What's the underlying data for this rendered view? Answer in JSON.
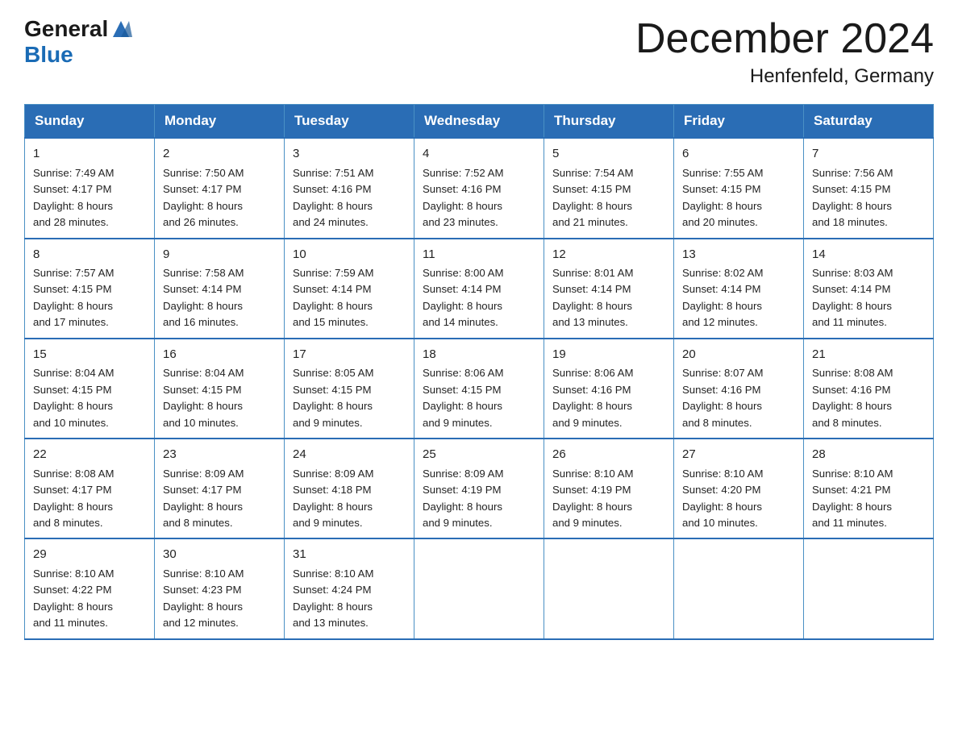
{
  "logo": {
    "text_general": "General",
    "text_blue": "Blue"
  },
  "title": "December 2024",
  "location": "Henfenfeld, Germany",
  "weekdays": [
    "Sunday",
    "Monday",
    "Tuesday",
    "Wednesday",
    "Thursday",
    "Friday",
    "Saturday"
  ],
  "weeks": [
    [
      {
        "day": "1",
        "sunrise": "7:49 AM",
        "sunset": "4:17 PM",
        "daylight": "8 hours and 28 minutes."
      },
      {
        "day": "2",
        "sunrise": "7:50 AM",
        "sunset": "4:17 PM",
        "daylight": "8 hours and 26 minutes."
      },
      {
        "day": "3",
        "sunrise": "7:51 AM",
        "sunset": "4:16 PM",
        "daylight": "8 hours and 24 minutes."
      },
      {
        "day": "4",
        "sunrise": "7:52 AM",
        "sunset": "4:16 PM",
        "daylight": "8 hours and 23 minutes."
      },
      {
        "day": "5",
        "sunrise": "7:54 AM",
        "sunset": "4:15 PM",
        "daylight": "8 hours and 21 minutes."
      },
      {
        "day": "6",
        "sunrise": "7:55 AM",
        "sunset": "4:15 PM",
        "daylight": "8 hours and 20 minutes."
      },
      {
        "day": "7",
        "sunrise": "7:56 AM",
        "sunset": "4:15 PM",
        "daylight": "8 hours and 18 minutes."
      }
    ],
    [
      {
        "day": "8",
        "sunrise": "7:57 AM",
        "sunset": "4:15 PM",
        "daylight": "8 hours and 17 minutes."
      },
      {
        "day": "9",
        "sunrise": "7:58 AM",
        "sunset": "4:14 PM",
        "daylight": "8 hours and 16 minutes."
      },
      {
        "day": "10",
        "sunrise": "7:59 AM",
        "sunset": "4:14 PM",
        "daylight": "8 hours and 15 minutes."
      },
      {
        "day": "11",
        "sunrise": "8:00 AM",
        "sunset": "4:14 PM",
        "daylight": "8 hours and 14 minutes."
      },
      {
        "day": "12",
        "sunrise": "8:01 AM",
        "sunset": "4:14 PM",
        "daylight": "8 hours and 13 minutes."
      },
      {
        "day": "13",
        "sunrise": "8:02 AM",
        "sunset": "4:14 PM",
        "daylight": "8 hours and 12 minutes."
      },
      {
        "day": "14",
        "sunrise": "8:03 AM",
        "sunset": "4:14 PM",
        "daylight": "8 hours and 11 minutes."
      }
    ],
    [
      {
        "day": "15",
        "sunrise": "8:04 AM",
        "sunset": "4:15 PM",
        "daylight": "8 hours and 10 minutes."
      },
      {
        "day": "16",
        "sunrise": "8:04 AM",
        "sunset": "4:15 PM",
        "daylight": "8 hours and 10 minutes."
      },
      {
        "day": "17",
        "sunrise": "8:05 AM",
        "sunset": "4:15 PM",
        "daylight": "8 hours and 9 minutes."
      },
      {
        "day": "18",
        "sunrise": "8:06 AM",
        "sunset": "4:15 PM",
        "daylight": "8 hours and 9 minutes."
      },
      {
        "day": "19",
        "sunrise": "8:06 AM",
        "sunset": "4:16 PM",
        "daylight": "8 hours and 9 minutes."
      },
      {
        "day": "20",
        "sunrise": "8:07 AM",
        "sunset": "4:16 PM",
        "daylight": "8 hours and 8 minutes."
      },
      {
        "day": "21",
        "sunrise": "8:08 AM",
        "sunset": "4:16 PM",
        "daylight": "8 hours and 8 minutes."
      }
    ],
    [
      {
        "day": "22",
        "sunrise": "8:08 AM",
        "sunset": "4:17 PM",
        "daylight": "8 hours and 8 minutes."
      },
      {
        "day": "23",
        "sunrise": "8:09 AM",
        "sunset": "4:17 PM",
        "daylight": "8 hours and 8 minutes."
      },
      {
        "day": "24",
        "sunrise": "8:09 AM",
        "sunset": "4:18 PM",
        "daylight": "8 hours and 9 minutes."
      },
      {
        "day": "25",
        "sunrise": "8:09 AM",
        "sunset": "4:19 PM",
        "daylight": "8 hours and 9 minutes."
      },
      {
        "day": "26",
        "sunrise": "8:10 AM",
        "sunset": "4:19 PM",
        "daylight": "8 hours and 9 minutes."
      },
      {
        "day": "27",
        "sunrise": "8:10 AM",
        "sunset": "4:20 PM",
        "daylight": "8 hours and 10 minutes."
      },
      {
        "day": "28",
        "sunrise": "8:10 AM",
        "sunset": "4:21 PM",
        "daylight": "8 hours and 11 minutes."
      }
    ],
    [
      {
        "day": "29",
        "sunrise": "8:10 AM",
        "sunset": "4:22 PM",
        "daylight": "8 hours and 11 minutes."
      },
      {
        "day": "30",
        "sunrise": "8:10 AM",
        "sunset": "4:23 PM",
        "daylight": "8 hours and 12 minutes."
      },
      {
        "day": "31",
        "sunrise": "8:10 AM",
        "sunset": "4:24 PM",
        "daylight": "8 hours and 13 minutes."
      },
      null,
      null,
      null,
      null
    ]
  ],
  "labels": {
    "sunrise": "Sunrise:",
    "sunset": "Sunset:",
    "daylight": "Daylight:"
  }
}
